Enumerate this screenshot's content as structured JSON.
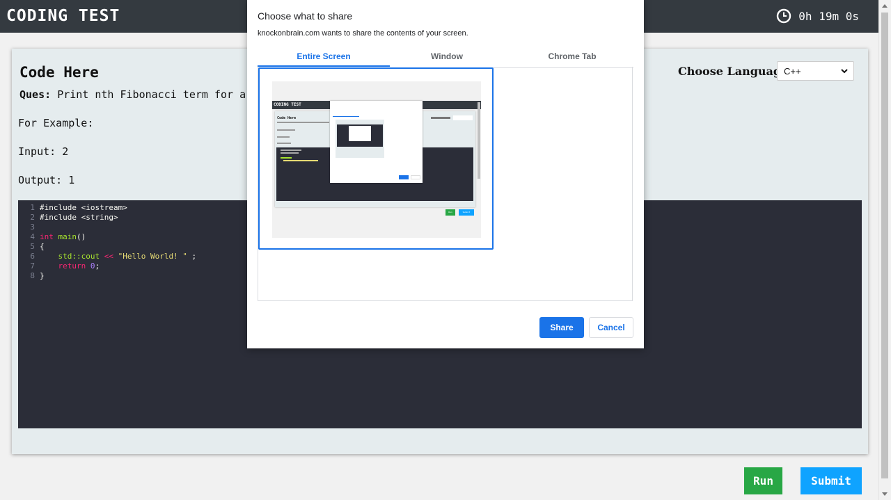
{
  "header": {
    "app_title": "CODING TEST",
    "timer": "0h 19m 0s",
    "clock_icon": "clock-icon"
  },
  "main": {
    "code_title": "Code Here",
    "question_label": "Ques:",
    "question_text": "Print nth Fibonacci term for a",
    "example_heading": "For Example:",
    "example_input": "Input: 2",
    "example_output": "Output: 1",
    "language_label": "Choose Language",
    "language_selected": "C++"
  },
  "editor": {
    "lines": [
      {
        "num": "1",
        "text": "#include <iostream>"
      },
      {
        "num": "2",
        "text": "#include <string>"
      },
      {
        "num": "3",
        "text": ""
      },
      {
        "num": "4",
        "a": "int",
        "b": " main",
        "c": "()"
      },
      {
        "num": "5",
        "text": "{"
      },
      {
        "num": "6",
        "a": "    std::cout ",
        "b": "<<",
        "c": " \"Hello World! \"",
        "d": " ;"
      },
      {
        "num": "7",
        "a": "    return ",
        "b": "0",
        "c": ";"
      },
      {
        "num": "8",
        "text": "}"
      }
    ]
  },
  "buttons": {
    "run": "Run",
    "submit": "Submit"
  },
  "dialog": {
    "title": "Choose what to share",
    "subtitle": "knockonbrain.com wants to share the contents of your screen.",
    "tabs": [
      "Entire Screen",
      "Window",
      "Chrome Tab"
    ],
    "active_tab": "Entire Screen",
    "share": "Share",
    "cancel": "Cancel"
  },
  "thumbnail": {
    "app_title": "CODING TEST",
    "code_title": "Code Here",
    "run": "Run",
    "submit": "Submit"
  },
  "colors": {
    "header_bg": "#343a40",
    "editor_bg": "#2b2d38",
    "run": "#28a745",
    "submit": "#0fa3ff",
    "accent": "#1a73e8"
  }
}
